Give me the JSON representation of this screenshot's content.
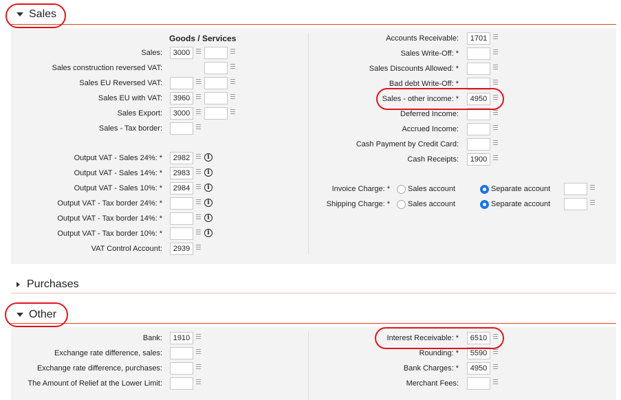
{
  "sections": {
    "sales": "Sales",
    "purchases": "Purchases",
    "other": "Other"
  },
  "sales": {
    "goods_services_header": "Goods / Services",
    "left": [
      {
        "label": "Sales:",
        "v1": "3000",
        "v2": ""
      },
      {
        "label": "Sales construction reversed VAT:",
        "v2": ""
      },
      {
        "label": "Sales EU Reversed VAT:",
        "v1": "",
        "v2": ""
      },
      {
        "label": "Sales EU with VAT:",
        "v1": "3960",
        "v2": ""
      },
      {
        "label": "Sales Export:",
        "v1": "3000",
        "v2": ""
      },
      {
        "label": "Sales - Tax border:",
        "v1": ""
      }
    ],
    "vat": [
      {
        "label": "Output VAT - Sales 24%: *",
        "v": "2982",
        "info": true
      },
      {
        "label": "Output VAT - Sales 14%: *",
        "v": "2983",
        "info": true
      },
      {
        "label": "Output VAT - Sales 10%: *",
        "v": "2984",
        "info": true
      },
      {
        "label": "Output VAT - Tax border 24%: *",
        "v": "",
        "info": true
      },
      {
        "label": "Output VAT - Tax border 14%: *",
        "v": "",
        "info": true
      },
      {
        "label": "Output VAT - Tax border 10%: *",
        "v": "",
        "info": true
      },
      {
        "label": "VAT Control Account:",
        "v": "2939",
        "info": false
      }
    ],
    "right": [
      {
        "label": "Accounts Receivable:",
        "v": "1701"
      },
      {
        "label": "Sales Write-Off: *",
        "v": ""
      },
      {
        "label": "Sales Discounts Allowed: *",
        "v": ""
      },
      {
        "label": "Bad debt Write-Off: *",
        "v": ""
      },
      {
        "label": "Sales - other income: *",
        "v": "4950"
      },
      {
        "label": "Deferred Income:",
        "v": ""
      },
      {
        "label": "Accrued Income:",
        "v": ""
      },
      {
        "label": "Cash Payment by Credit Card:",
        "v": ""
      },
      {
        "label": "Cash Receipts:",
        "v": "1900"
      }
    ],
    "charges": [
      {
        "label": "Invoice Charge: *",
        "opt1": "Sales account",
        "opt2": "Separate account",
        "selected": "Separate account",
        "v": ""
      },
      {
        "label": "Shipping Charge: *",
        "opt1": "Sales account",
        "opt2": "Separate account",
        "selected": "Separate account",
        "v": ""
      }
    ]
  },
  "other": {
    "left": [
      {
        "label": "Bank:",
        "v": "1910"
      },
      {
        "label": "Exchange rate difference, sales:",
        "v": ""
      },
      {
        "label": "Exchange rate difference, purchases:",
        "v": ""
      },
      {
        "label": "The Amount of Relief at the Lower Limit:",
        "v": ""
      }
    ],
    "right": [
      {
        "label": "Interest Receivable: *",
        "v": "6510"
      },
      {
        "label": "Rounding: *",
        "v": "5590"
      },
      {
        "label": "Bank Charges: *",
        "v": "4950"
      },
      {
        "label": "Merchant Fees:",
        "v": ""
      }
    ]
  },
  "colors": {
    "accent_line": "#e0441c",
    "highlight_oval": "#e0141c",
    "radio_selected": "#1a73e8"
  }
}
